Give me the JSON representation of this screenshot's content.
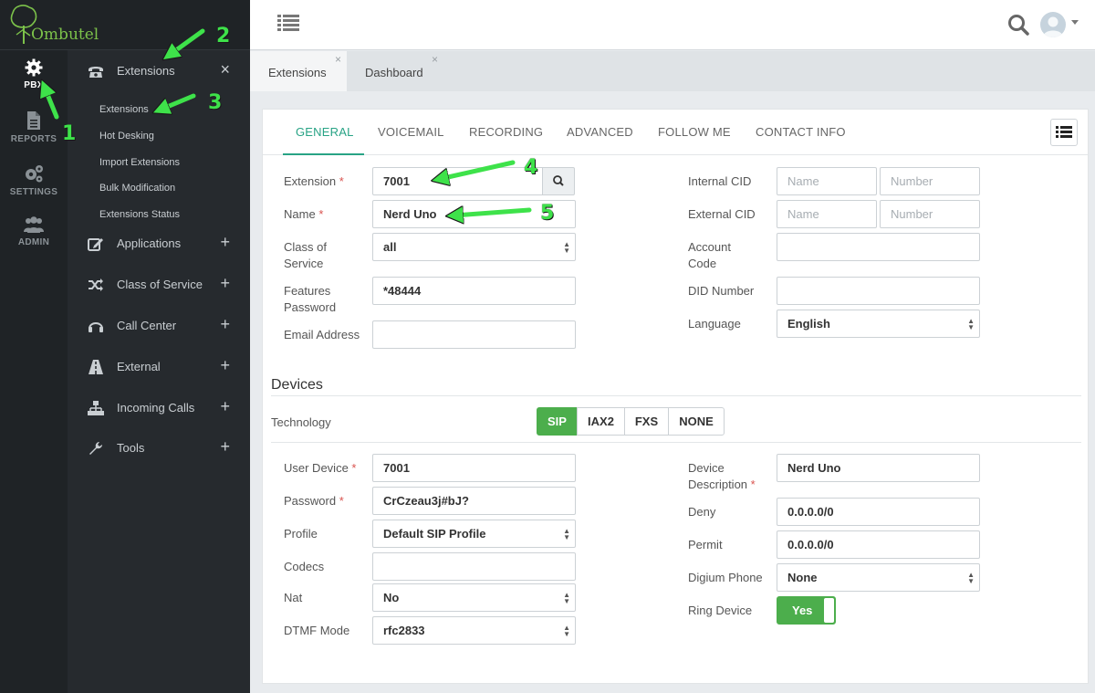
{
  "app": {
    "logo_text": "Ombutel"
  },
  "rail": [
    {
      "label": "PBX",
      "icon": "gear-icon"
    },
    {
      "label": "REPORTS",
      "icon": "document-icon"
    },
    {
      "label": "SETTINGS",
      "icon": "gears-icon"
    },
    {
      "label": "ADMIN",
      "icon": "users-icon"
    }
  ],
  "submenu": {
    "groups": [
      {
        "label": "Extensions",
        "icon": "phone-icon",
        "control": "×"
      },
      {
        "label": "Applications",
        "icon": "edit-icon",
        "control": "+"
      },
      {
        "label": "Class of Service",
        "icon": "shuffle-icon",
        "control": "+"
      },
      {
        "label": "Call Center",
        "icon": "headphones-icon",
        "control": "+"
      },
      {
        "label": "External",
        "icon": "road-icon",
        "control": "+"
      },
      {
        "label": "Incoming Calls",
        "icon": "sitemap-icon",
        "control": "+"
      },
      {
        "label": "Tools",
        "icon": "wrench-icon",
        "control": "+"
      }
    ],
    "extension_items": [
      "Extensions",
      "Hot Desking",
      "Import Extensions",
      "Bulk Modification",
      "Extensions Status"
    ]
  },
  "tabs": [
    {
      "label": "Extensions",
      "close": "×"
    },
    {
      "label": "Dashboard",
      "close": "×"
    }
  ],
  "form_tabs": [
    "GENERAL",
    "VOICEMAIL",
    "RECORDING",
    "ADVANCED",
    "FOLLOW ME",
    "CONTACT INFO"
  ],
  "general": {
    "extension": {
      "label": "Extension",
      "value": "7001"
    },
    "name": {
      "label": "Name",
      "value": "Nerd Uno"
    },
    "class_of_service": {
      "label_1": "Class of",
      "label_2": "Service",
      "value": "all"
    },
    "features_password": {
      "label_1": "Features",
      "label_2": "Password",
      "value": "*48444"
    },
    "email_address": {
      "label": "Email Address",
      "value": ""
    },
    "internal_cid": {
      "label": "Internal CID",
      "name_placeholder": "Name",
      "number_placeholder": "Number"
    },
    "external_cid": {
      "label": "External CID",
      "name_placeholder": "Name",
      "number_placeholder": "Number"
    },
    "account_code": {
      "label_1": "Account",
      "label_2": "Code",
      "value": ""
    },
    "did_number": {
      "label": "DID Number",
      "value": ""
    },
    "language": {
      "label": "Language",
      "value": "English"
    },
    "required_mark": "*"
  },
  "devices": {
    "title": "Devices",
    "technology_label": "Technology",
    "technologies": [
      "SIP",
      "IAX2",
      "FXS",
      "NONE"
    ],
    "active_technology": "SIP",
    "user_device": {
      "label": "User Device",
      "value": "7001"
    },
    "password": {
      "label": "Password",
      "value": "CrCzeau3j#bJ?"
    },
    "profile": {
      "label": "Profile",
      "value": "Default SIP Profile"
    },
    "codecs": {
      "label": "Codecs",
      "value": ""
    },
    "nat": {
      "label": "Nat",
      "value": "No"
    },
    "dtmf_mode": {
      "label": "DTMF Mode",
      "value": "rfc2833"
    },
    "device_description": {
      "label_1": "Device",
      "label_2": "Description",
      "value": "Nerd Uno"
    },
    "deny": {
      "label": "Deny",
      "value": "0.0.0.0/0"
    },
    "permit": {
      "label": "Permit",
      "value": "0.0.0.0/0"
    },
    "digium_phone": {
      "label": "Digium Phone",
      "value": "None"
    },
    "ring_device": {
      "label": "Ring Device",
      "value": "Yes"
    }
  },
  "annotations": [
    "1",
    "2",
    "3",
    "4",
    "5"
  ],
  "colors": {
    "accent": "#28a385",
    "success": "#4cae4c",
    "sidebar": "#1f2326",
    "annotation": "#3ee24a"
  }
}
